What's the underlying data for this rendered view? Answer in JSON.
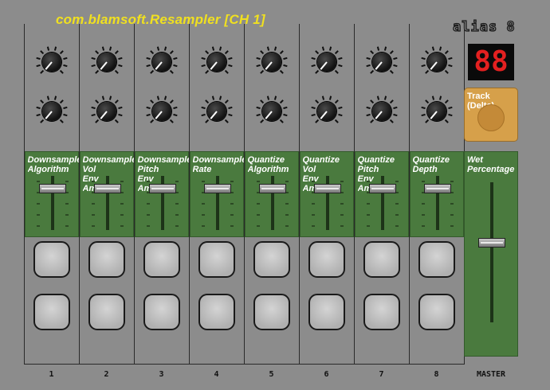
{
  "app": {
    "title": "com.blamsoft.Resampler  [CH 1]",
    "logo": "alias 8"
  },
  "strips": [
    {
      "fader_label": "Downsample\nAlgorithm",
      "fader_value": 0.76,
      "number": "1"
    },
    {
      "fader_label": "Downsample\nVol\nEnv\nAmt",
      "fader_value": 0.76,
      "number": "2"
    },
    {
      "fader_label": "Downsample\nPitch\nEnv\nAmt",
      "fader_value": 0.76,
      "number": "3"
    },
    {
      "fader_label": "Downsample\nRate",
      "fader_value": 0.76,
      "number": "4"
    },
    {
      "fader_label": "Quantize\nAlgorithm",
      "fader_value": 0.76,
      "number": "5"
    },
    {
      "fader_label": "Quantize\nVol\nEnv\nAmt",
      "fader_value": 0.76,
      "number": "6"
    },
    {
      "fader_label": "Quantize\nPitch\nEnv\nAmt",
      "fader_value": 0.76,
      "number": "7"
    },
    {
      "fader_label": "Quantize\nDepth",
      "fader_value": 0.76,
      "number": "8"
    }
  ],
  "display": {
    "value": "88",
    "color": "#e32020"
  },
  "track_button": {
    "label": "Track\n(Delta)",
    "color": "#d6a04a"
  },
  "master": {
    "fader_label": "Wet\nPercentage",
    "fader_value": 0.57,
    "label": "MASTER"
  },
  "colors": {
    "background": "#8c8c8c",
    "fader_panel": "#4a7a3e",
    "title": "#f0e020"
  }
}
